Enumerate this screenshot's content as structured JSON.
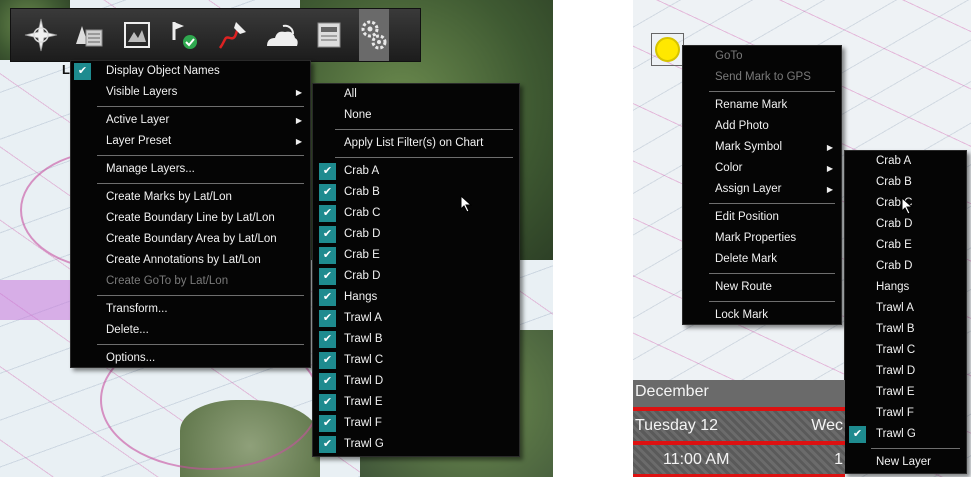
{
  "toolbar": {
    "icons": [
      "compass-rose-icon",
      "layers-icon",
      "chart-frame-icon",
      "route-icon",
      "track-icon",
      "weather-icon",
      "report-icon",
      "settings-gears-icon"
    ]
  },
  "main_menu": {
    "items": [
      {
        "label": "Display Object Names",
        "checked": true,
        "submenu": false,
        "disabled": false
      },
      {
        "label": "Visible Layers",
        "checked": false,
        "submenu": true,
        "disabled": false
      },
      {
        "sep": true
      },
      {
        "label": "Active Layer",
        "checked": false,
        "submenu": true,
        "disabled": false
      },
      {
        "label": "Layer Preset",
        "checked": false,
        "submenu": true,
        "disabled": false
      },
      {
        "sep": true
      },
      {
        "label": "Manage Layers...",
        "checked": false,
        "submenu": false,
        "disabled": false
      },
      {
        "sep": true
      },
      {
        "label": "Create Marks by Lat/Lon",
        "checked": false,
        "submenu": false,
        "disabled": false
      },
      {
        "label": "Create Boundary Line by Lat/Lon",
        "checked": false,
        "submenu": false,
        "disabled": false
      },
      {
        "label": "Create Boundary Area by Lat/Lon",
        "checked": false,
        "submenu": false,
        "disabled": false
      },
      {
        "label": "Create Annotations by Lat/Lon",
        "checked": false,
        "submenu": false,
        "disabled": false
      },
      {
        "label": "Create GoTo by Lat/Lon",
        "checked": false,
        "submenu": false,
        "disabled": true
      },
      {
        "sep": true
      },
      {
        "label": "Transform...",
        "checked": false,
        "submenu": false,
        "disabled": false
      },
      {
        "label": "Delete...",
        "checked": false,
        "submenu": false,
        "disabled": false
      },
      {
        "sep": true
      },
      {
        "label": "Options...",
        "checked": false,
        "submenu": false,
        "disabled": false
      }
    ]
  },
  "layers_submenu": {
    "items": [
      {
        "label": "All",
        "checked": false
      },
      {
        "label": "None",
        "checked": false
      },
      {
        "sep": true
      },
      {
        "label": "Apply List Filter(s) on Chart",
        "checked": false
      },
      {
        "sep": true
      },
      {
        "label": "Crab A",
        "checked": true
      },
      {
        "label": "Crab B",
        "checked": true
      },
      {
        "label": "Crab C",
        "checked": true
      },
      {
        "label": "Crab D",
        "checked": true
      },
      {
        "label": "Crab E",
        "checked": true
      },
      {
        "label": "Crab D",
        "checked": true
      },
      {
        "label": "Hangs",
        "checked": true
      },
      {
        "label": "Trawl A",
        "checked": true
      },
      {
        "label": "Trawl B",
        "checked": true
      },
      {
        "label": "Trawl C",
        "checked": true
      },
      {
        "label": "Trawl D",
        "checked": true
      },
      {
        "label": "Trawl E",
        "checked": true
      },
      {
        "label": "Trawl F",
        "checked": true
      },
      {
        "label": "Trawl G",
        "checked": true
      }
    ]
  },
  "mark_menu": {
    "items": [
      {
        "label": "GoTo",
        "disabled": true,
        "submenu": false
      },
      {
        "label": "Send Mark to GPS",
        "disabled": true,
        "submenu": false
      },
      {
        "sep": true
      },
      {
        "label": "Rename Mark",
        "disabled": false,
        "submenu": false
      },
      {
        "label": "Add Photo",
        "disabled": false,
        "submenu": false
      },
      {
        "label": "Mark Symbol",
        "disabled": false,
        "submenu": true
      },
      {
        "label": "Color",
        "disabled": false,
        "submenu": true
      },
      {
        "label": "Assign Layer",
        "disabled": false,
        "submenu": true
      },
      {
        "sep": true
      },
      {
        "label": "Edit Position",
        "disabled": false,
        "submenu": false
      },
      {
        "label": "Mark Properties",
        "disabled": false,
        "submenu": false
      },
      {
        "label": "Delete Mark",
        "disabled": false,
        "submenu": false
      },
      {
        "sep": true
      },
      {
        "label": "New Route",
        "disabled": false,
        "submenu": false
      },
      {
        "sep": true
      },
      {
        "label": "Lock Mark",
        "disabled": false,
        "submenu": false
      }
    ]
  },
  "assign_layer_submenu": {
    "items": [
      {
        "label": "Crab A",
        "checked": false
      },
      {
        "label": "Crab B",
        "checked": false
      },
      {
        "label": "Crab C",
        "checked": false
      },
      {
        "label": "Crab D",
        "checked": false
      },
      {
        "label": "Crab E",
        "checked": false
      },
      {
        "label": "Crab D",
        "checked": false
      },
      {
        "label": "Hangs",
        "checked": false
      },
      {
        "label": "Trawl A",
        "checked": false
      },
      {
        "label": "Trawl B",
        "checked": false
      },
      {
        "label": "Trawl C",
        "checked": false
      },
      {
        "label": "Trawl D",
        "checked": false
      },
      {
        "label": "Trawl E",
        "checked": false
      },
      {
        "label": "Trawl F",
        "checked": false
      },
      {
        "label": "Trawl G",
        "checked": true
      },
      {
        "sep": true
      },
      {
        "label": "New Layer",
        "checked": false
      }
    ]
  },
  "datetime": {
    "month": "December",
    "day": "Tuesday 12",
    "day_right": "Wec",
    "time": "11:00 AM",
    "time_right": "1"
  },
  "map_labels": [
    "L"
  ],
  "colors": {
    "menu_bg": "#050505",
    "check_teal": "#1e8b8f",
    "mark_yellow": "#ffe800",
    "accent_red": "#dd1111"
  }
}
